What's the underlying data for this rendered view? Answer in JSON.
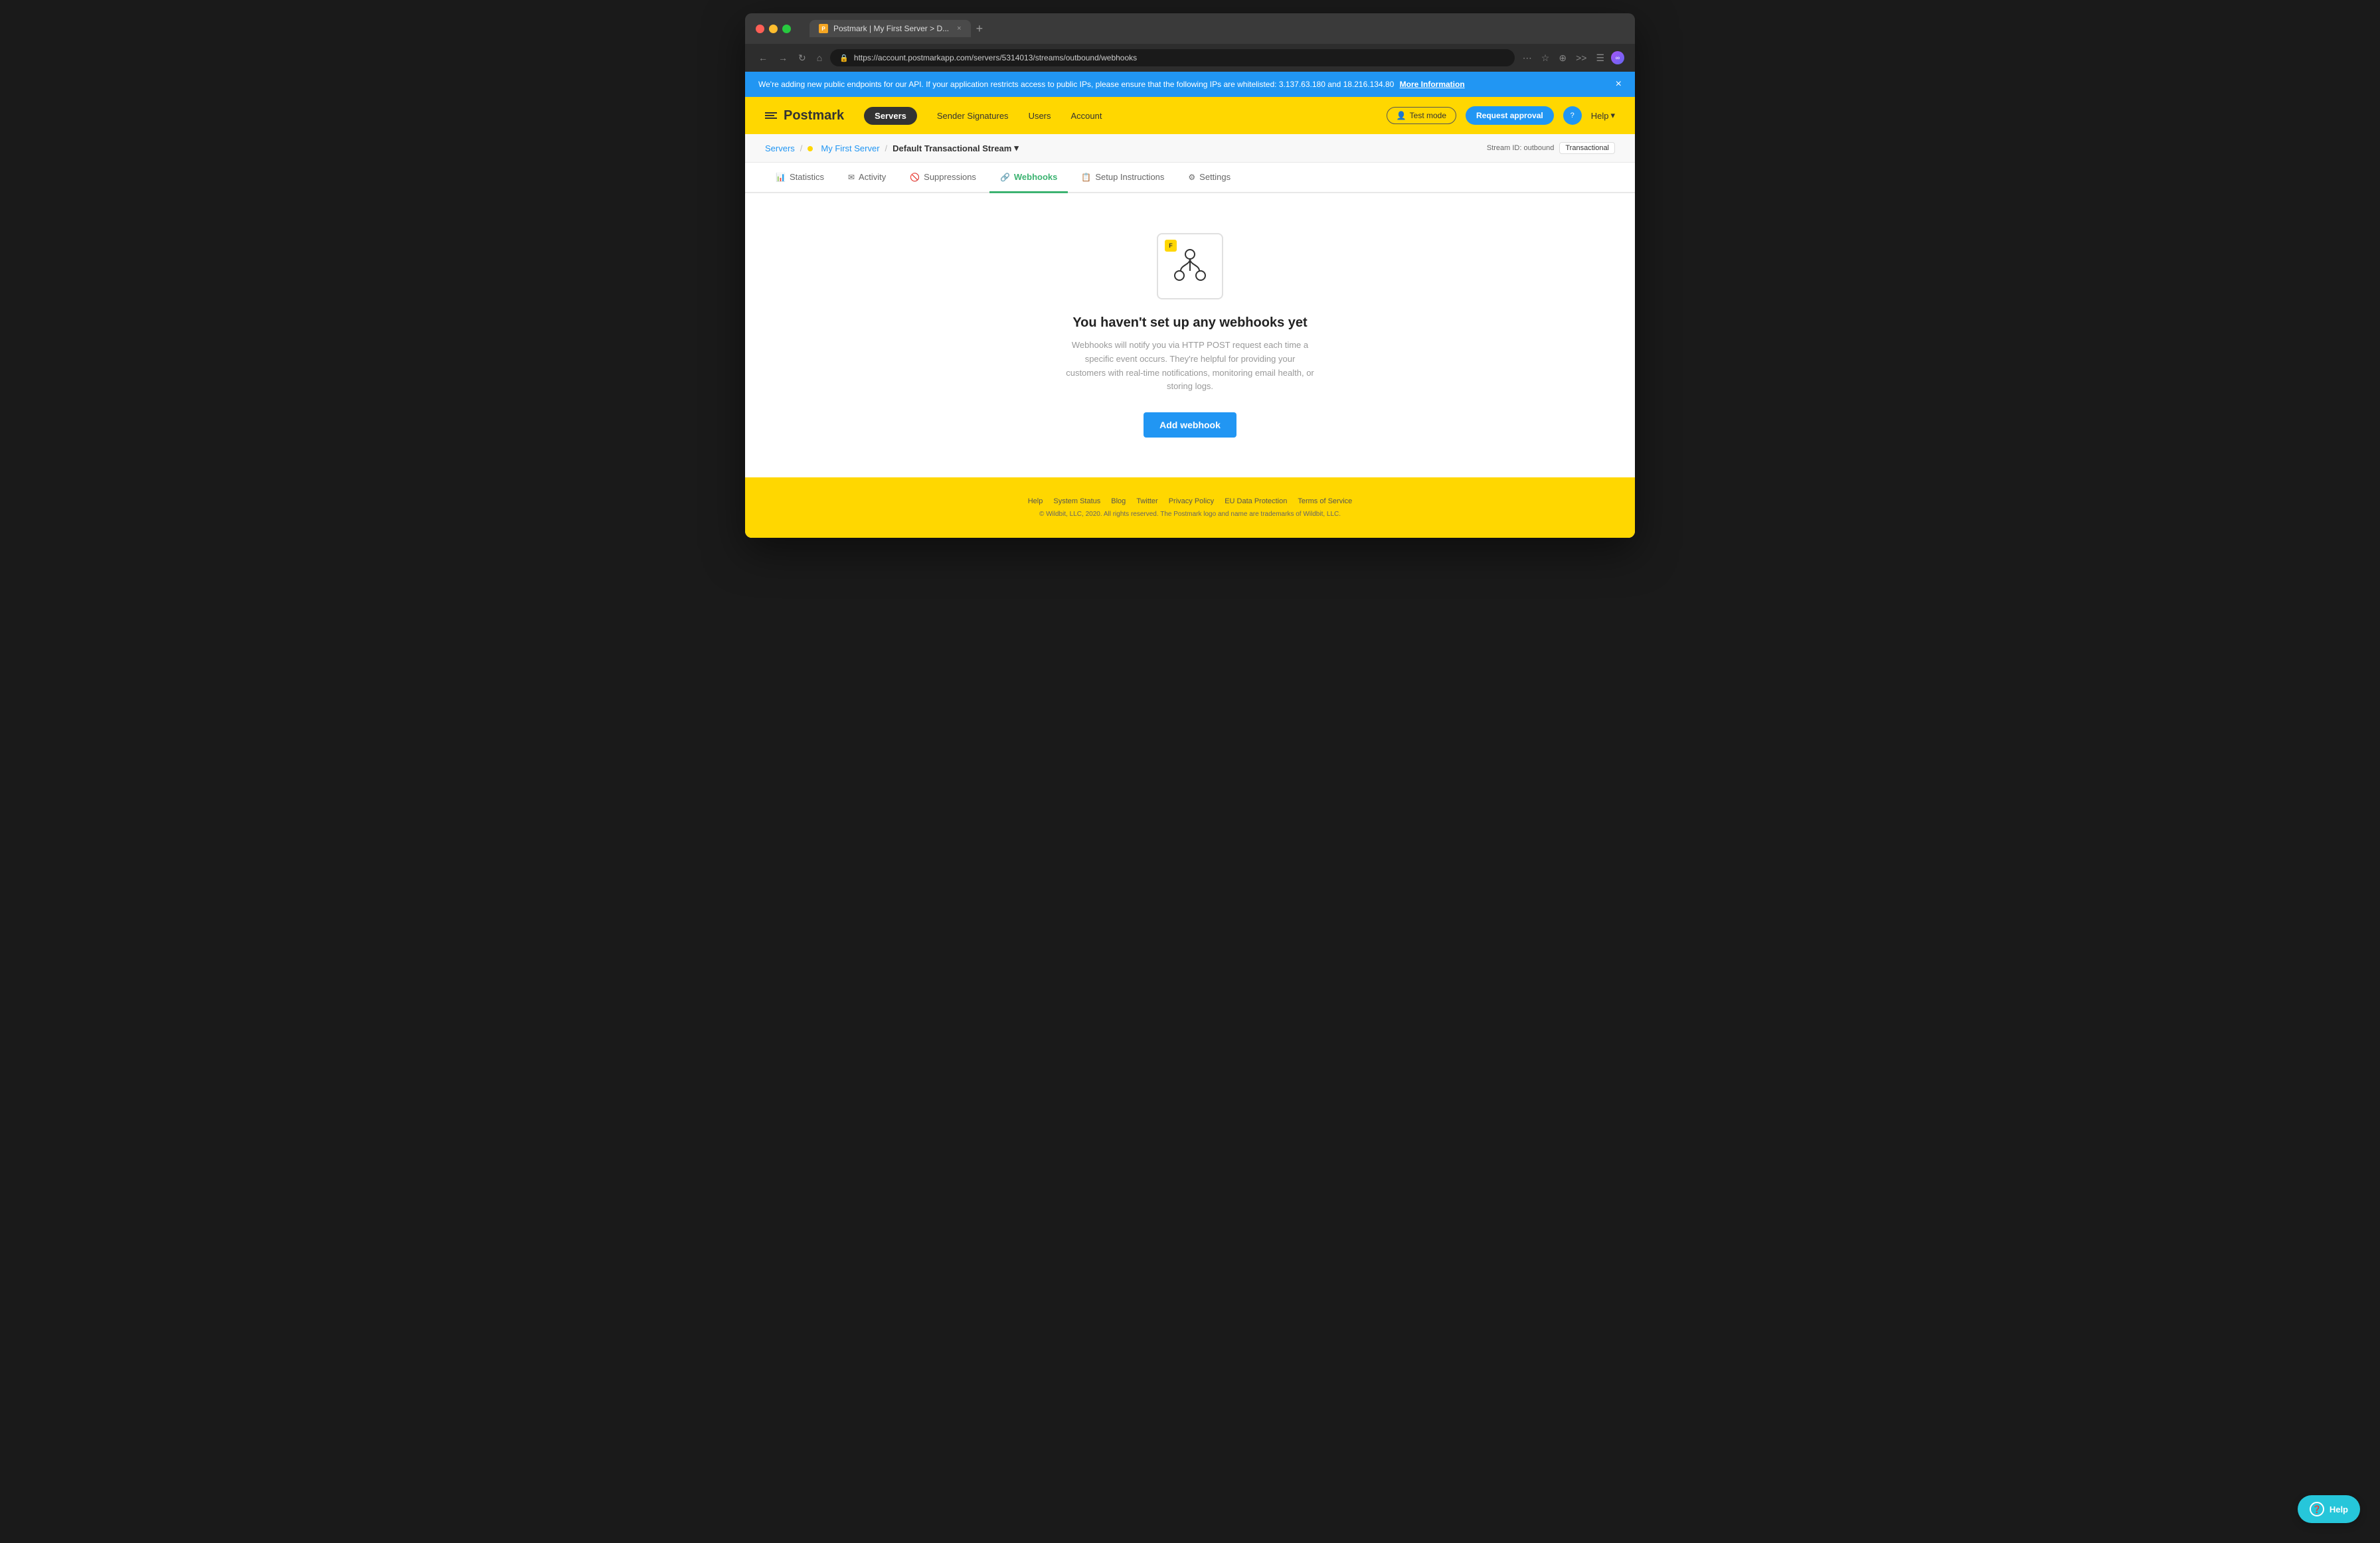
{
  "browser": {
    "tab_title": "Postmark | My First Server > D...",
    "url": "https://account.postmarkapp.com/servers/5314013/streams/outbound/webhooks",
    "new_tab_label": "+"
  },
  "banner": {
    "text": "We're adding new public endpoints for our API. If your application restricts access to public IPs, please ensure that the following IPs are whitelisted: 3.137.63.180 and 18.216.134.80",
    "link_text": "More Information",
    "close_label": "×"
  },
  "nav": {
    "logo_text": "Postmark",
    "servers_btn": "Servers",
    "links": [
      {
        "label": "Sender Signatures"
      },
      {
        "label": "Users"
      },
      {
        "label": "Account"
      }
    ],
    "test_mode_label": "Test mode",
    "request_approval_label": "Request approval",
    "help_label": "Help"
  },
  "breadcrumb": {
    "servers_label": "Servers",
    "server_name": "My First Server",
    "stream_name": "Default Transactional Stream",
    "stream_id_label": "Stream ID: outbound",
    "stream_badge": "Transactional"
  },
  "subnav": {
    "items": [
      {
        "id": "statistics",
        "label": "Statistics",
        "icon": "📊",
        "active": false
      },
      {
        "id": "activity",
        "label": "Activity",
        "icon": "✉",
        "active": false
      },
      {
        "id": "suppressions",
        "label": "Suppressions",
        "icon": "🚫",
        "active": false
      },
      {
        "id": "webhooks",
        "label": "Webhooks",
        "icon": "🔗",
        "active": true
      },
      {
        "id": "setup-instructions",
        "label": "Setup Instructions",
        "icon": "📋",
        "active": false
      },
      {
        "id": "settings",
        "label": "Settings",
        "icon": "⚙",
        "active": false
      }
    ]
  },
  "main": {
    "empty_title": "You haven't set up any webhooks yet",
    "empty_desc": "Webhooks will notify you via HTTP POST request each time a specific event occurs. They're helpful for providing your customers with real-time notifications, monitoring email health, or storing logs.",
    "add_webhook_label": "Add webhook"
  },
  "footer": {
    "links": [
      {
        "label": "Help"
      },
      {
        "label": "System Status"
      },
      {
        "label": "Blog"
      },
      {
        "label": "Twitter"
      },
      {
        "label": "Privacy Policy"
      },
      {
        "label": "EU Data Protection"
      },
      {
        "label": "Terms of Service"
      }
    ],
    "copyright": "© Wildbit, LLC, 2020. All rights reserved. The Postmark logo and name are trademarks of Wildbit, LLC."
  },
  "help_bubble": {
    "label": "Help"
  }
}
